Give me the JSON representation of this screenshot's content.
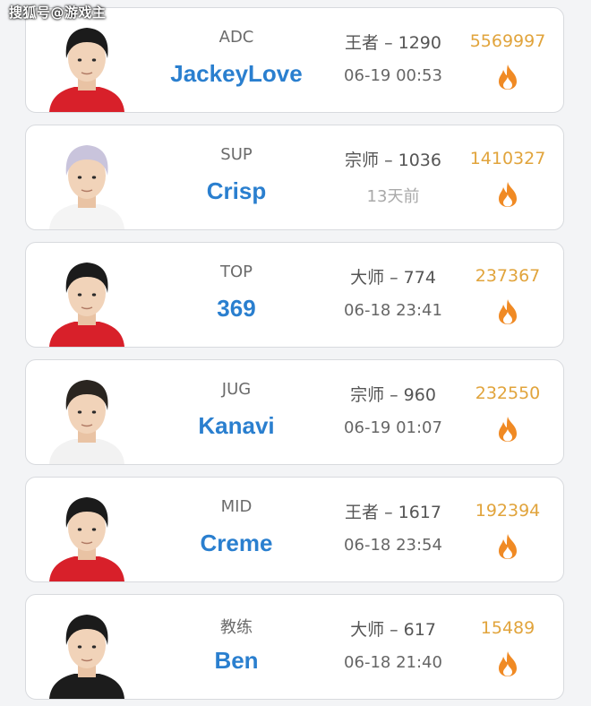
{
  "watermark": "搜狐号@游戏主",
  "colors": {
    "name": "#2a7fcf",
    "hot": "#e1a43c",
    "flame": "#f08a24"
  },
  "players": [
    {
      "role": "ADC",
      "name": "JackeyLove",
      "rank": "王者 – 1290",
      "time": "06-19 00:53",
      "hot": "5569997",
      "time_dim": false,
      "hair": "#1b1b1b",
      "jersey": "#d8202a"
    },
    {
      "role": "SUP",
      "name": "Crisp",
      "rank": "宗师 – 1036",
      "time": "13天前",
      "hot": "1410327",
      "time_dim": true,
      "hair": "#c9c4dc",
      "jersey": "#f4f4f4"
    },
    {
      "role": "TOP",
      "name": "369",
      "rank": "大师 – 774",
      "time": "06-18 23:41",
      "hot": "237367",
      "time_dim": false,
      "hair": "#1b1b1b",
      "jersey": "#d8202a"
    },
    {
      "role": "JUG",
      "name": "Kanavi",
      "rank": "宗师 – 960",
      "time": "06-19 01:07",
      "hot": "232550",
      "time_dim": false,
      "hair": "#2a2520",
      "jersey": "#f2f2f2"
    },
    {
      "role": "MID",
      "name": "Creme",
      "rank": "王者 – 1617",
      "time": "06-18 23:54",
      "hot": "192394",
      "time_dim": false,
      "hair": "#1b1b1b",
      "jersey": "#d8202a"
    },
    {
      "role": "教练",
      "name": "Ben",
      "rank": "大师 – 617",
      "time": "06-18 21:40",
      "hot": "15489",
      "time_dim": false,
      "hair": "#1b1b1b",
      "jersey": "#1c1c1c"
    }
  ]
}
